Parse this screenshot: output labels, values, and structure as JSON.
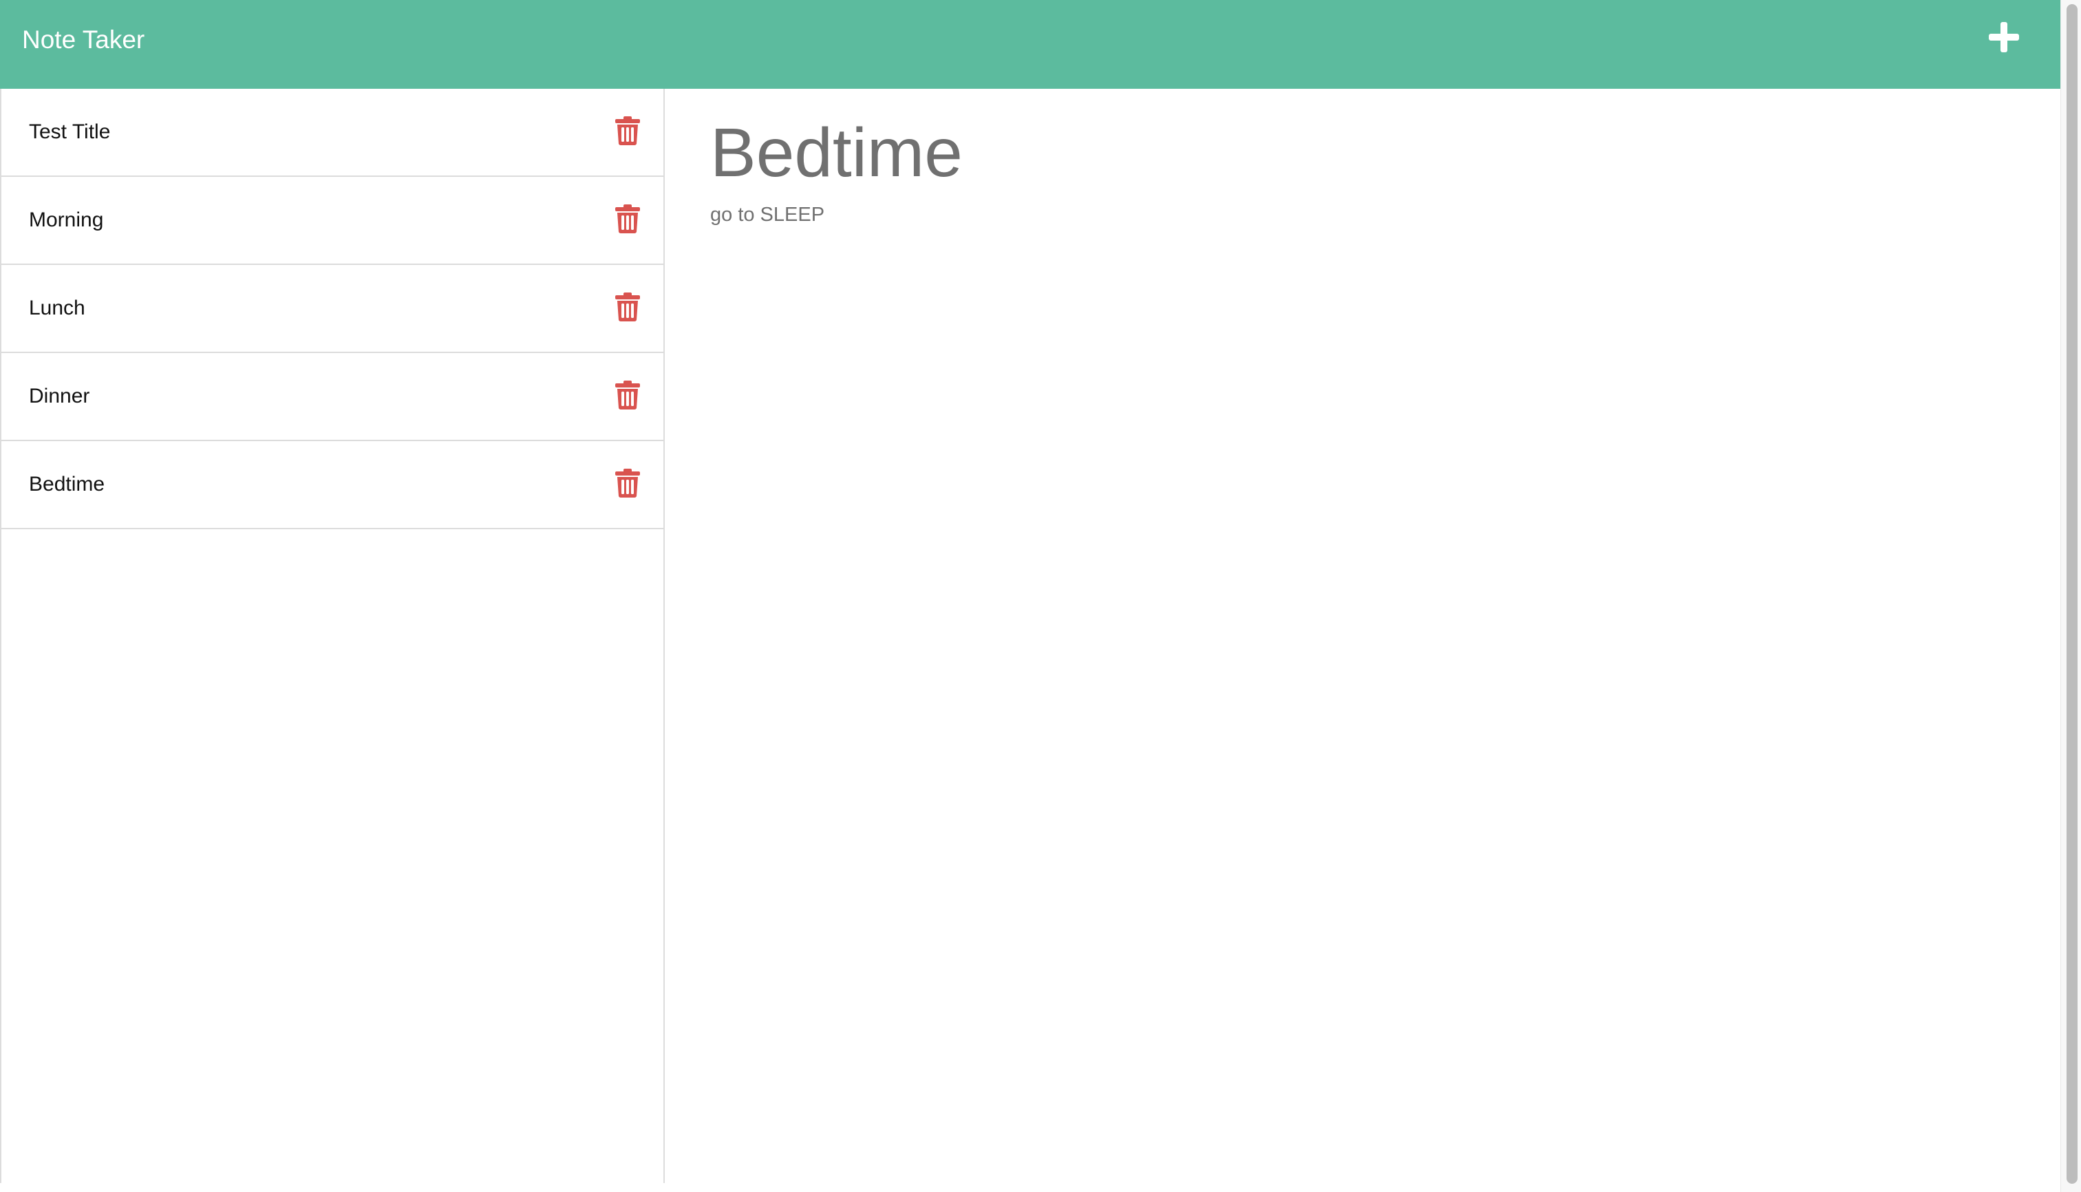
{
  "app": {
    "title": "Note Taker"
  },
  "header": {
    "new_note_icon": "plus-icon"
  },
  "notes": [
    {
      "title": "Test Title",
      "delete_icon": "trash-icon"
    },
    {
      "title": "Morning",
      "delete_icon": "trash-icon"
    },
    {
      "title": "Lunch",
      "delete_icon": "trash-icon"
    },
    {
      "title": "Dinner",
      "delete_icon": "trash-icon"
    },
    {
      "title": "Bedtime",
      "delete_icon": "trash-icon"
    }
  ],
  "active_note": {
    "title": "Bedtime",
    "text": "go to SLEEP"
  },
  "colors": {
    "header": "#5cbb9e",
    "delete": "#d9534f",
    "text_muted": "#707070"
  }
}
